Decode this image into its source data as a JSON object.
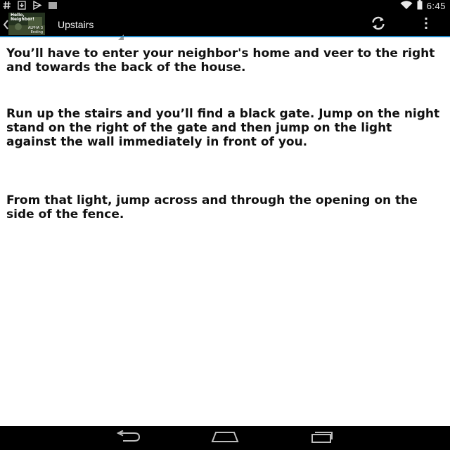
{
  "status_bar": {
    "time": "6:45",
    "icons": [
      "hash-icon",
      "download-icon",
      "play-store-icon",
      "barcode-icon",
      "wifi-icon",
      "battery-icon"
    ]
  },
  "action_bar": {
    "title": "Upstairs",
    "thumbnail": {
      "line1": "Hello,",
      "line2": "Neighbor!",
      "line3": "ALPHA 3",
      "line4": "Ending"
    },
    "icons": [
      "up-chevron-icon",
      "refresh-icon",
      "overflow-menu-icon"
    ]
  },
  "content": {
    "paragraphs": [
      "You’ll have to enter your neighbor's home and veer to the right and towards the back of the house.",
      "Run up the stairs and you’ll find a black gate. Jump on the night stand on the right of the gate and then jump on the light against the wall immediately in front of you.",
      "From that light, jump across and through the opening on the side of the fence."
    ]
  },
  "nav_bar": {
    "icons": [
      "back-icon",
      "home-icon",
      "recents-icon"
    ]
  },
  "colors": {
    "bar_background": "#000000",
    "accent_line": "#1e88c8",
    "content_background": "#ffffff",
    "text": "#111111"
  }
}
